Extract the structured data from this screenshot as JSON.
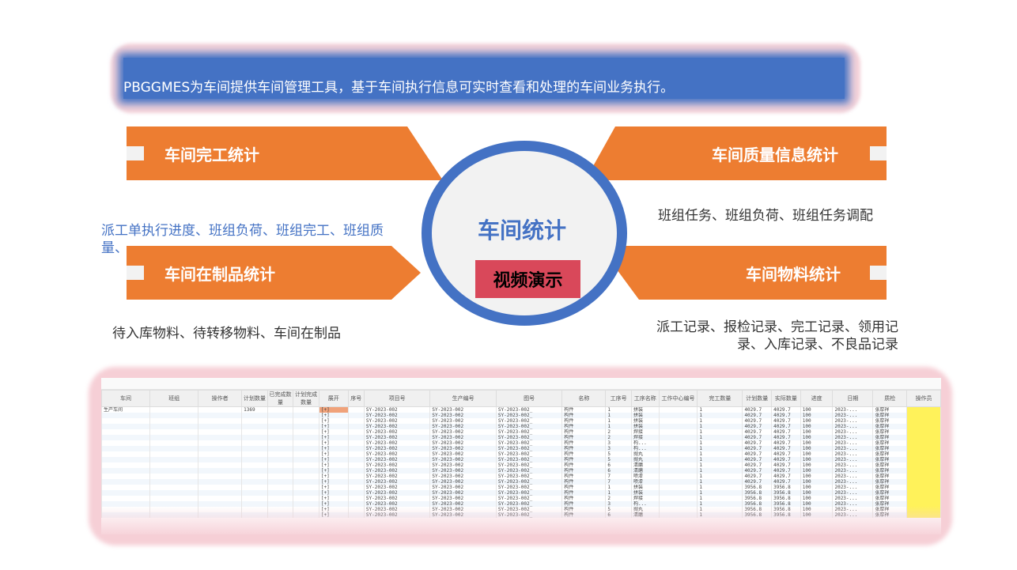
{
  "banner": {
    "text": "PBGGMES为车间提供车间管理工具，基于车间执行信息可实时查看和处理的车间业务执行。"
  },
  "center": {
    "title": "车间统计",
    "video_button": "视频演示"
  },
  "sections": {
    "completion": {
      "title": "车间完工统计",
      "desc": "派工单执行进度、班组负荷、班组完工、班组质量、"
    },
    "quality": {
      "title": "车间质量信息统计",
      "desc": "班组任务、班组负荷、班组任务调配"
    },
    "wip": {
      "title": "车间在制品统计",
      "desc": "待入库物料、待转移物料、车间在制品"
    },
    "material": {
      "title": "车间物料统计",
      "desc": "派工记录、报检记录、完工记录、领用记录、入库记录、不良品记录"
    }
  },
  "colors": {
    "accent_blue": "#4472c4",
    "accent_orange": "#ed7d31",
    "button_red": "#d9485a",
    "glow_pink": "#f6cfd6"
  },
  "table": {
    "headers": [
      "车间",
      "班组",
      "操作者",
      "计划数量",
      "已完成数量",
      "计划完成数量",
      "展开",
      "序号",
      "项目号",
      "生产编号",
      "图号",
      "名称",
      "工序号",
      "工序名称",
      "工作中心编号",
      "完工数量",
      "计划数量",
      "实际数量",
      "进度",
      "日期",
      "质检",
      "操作员"
    ],
    "workshop": "生产车间",
    "plan_qty": "1369",
    "open_marker": "[+]",
    "project_no": "SY-2023-002",
    "prod_no": "SY-2023-002",
    "drawing_no": "SY-2023-002_",
    "part_name": "构件",
    "date": "2023-...",
    "inspector": "张厚祥",
    "rows": [
      {
        "op": "1",
        "proc": "拼装",
        "done": "1",
        "q1": "4029.7",
        "q2": "4029.7",
        "pct": "100"
      },
      {
        "op": "1",
        "proc": "拼装",
        "done": "1",
        "q1": "4029.7",
        "q2": "4029.7",
        "pct": "100"
      },
      {
        "op": "1",
        "proc": "拼装",
        "done": "1",
        "q1": "4029.7",
        "q2": "4029.7",
        "pct": "100"
      },
      {
        "op": "1",
        "proc": "拼装",
        "done": "1",
        "q1": "4029.7",
        "q2": "4029.7",
        "pct": "100"
      },
      {
        "op": "2",
        "proc": "焊接",
        "done": "1",
        "q1": "4029.7",
        "q2": "4029.7",
        "pct": "100"
      },
      {
        "op": "2",
        "proc": "焊接",
        "done": "1",
        "q1": "4029.7",
        "q2": "4029.7",
        "pct": "100"
      },
      {
        "op": "3",
        "proc": "构...",
        "done": "1",
        "q1": "4029.7",
        "q2": "4029.7",
        "pct": "100"
      },
      {
        "op": "3",
        "proc": "构...",
        "done": "1",
        "q1": "4029.7",
        "q2": "4029.7",
        "pct": "100"
      },
      {
        "op": "5",
        "proc": "抛丸",
        "done": "1",
        "q1": "4029.7",
        "q2": "4029.7",
        "pct": "100"
      },
      {
        "op": "5",
        "proc": "抛丸",
        "done": "1",
        "q1": "4029.7",
        "q2": "4029.7",
        "pct": "100"
      },
      {
        "op": "6",
        "proc": "清磨",
        "done": "1",
        "q1": "4029.7",
        "q2": "4029.7",
        "pct": "100"
      },
      {
        "op": "6",
        "proc": "清磨",
        "done": "1",
        "q1": "4029.7",
        "q2": "4029.7",
        "pct": "100"
      },
      {
        "op": "7",
        "proc": "喷漆",
        "done": "1",
        "q1": "4029.7",
        "q2": "4029.7",
        "pct": "100"
      },
      {
        "op": "7",
        "proc": "喷漆",
        "done": "1",
        "q1": "4029.7",
        "q2": "4029.7",
        "pct": "100"
      },
      {
        "op": "1",
        "proc": "拼装",
        "done": "1",
        "q1": "3956.8",
        "q2": "3956.8",
        "pct": "100"
      },
      {
        "op": "1",
        "proc": "拼装",
        "done": "1",
        "q1": "3956.8",
        "q2": "3956.8",
        "pct": "100"
      },
      {
        "op": "2",
        "proc": "焊接",
        "done": "1",
        "q1": "3956.8",
        "q2": "3956.8",
        "pct": "100"
      },
      {
        "op": "3",
        "proc": "构...",
        "done": "1",
        "q1": "3956.8",
        "q2": "3956.8",
        "pct": "100"
      },
      {
        "op": "5",
        "proc": "抛丸",
        "done": "1",
        "q1": "3956.8",
        "q2": "3956.8",
        "pct": "100"
      },
      {
        "op": "6",
        "proc": "清磨",
        "done": "1",
        "q1": "3956.8",
        "q2": "3956.8",
        "pct": "100"
      }
    ]
  }
}
